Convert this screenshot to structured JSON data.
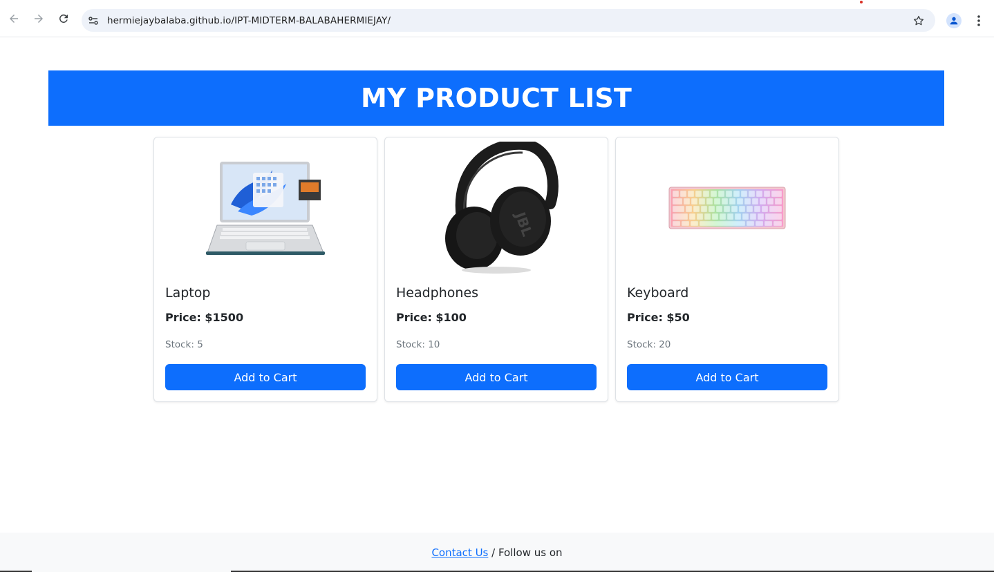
{
  "browser": {
    "url": "hermiejaybalaba.github.io/IPT-MIDTERM-BALABAHERMIEJAY/",
    "icons": [
      "back-icon",
      "forward-icon",
      "reload-icon",
      "site-info-icon",
      "bookmark-star-icon",
      "profile-icon",
      "menu-dots-icon"
    ]
  },
  "header": {
    "title": "MY PRODUCT LIST",
    "background": "#0d6efd"
  },
  "products": [
    {
      "name": "Laptop",
      "price": "Price: $1500",
      "stock": "Stock: 5",
      "button": "Add to Cart"
    },
    {
      "name": "Headphones",
      "price": "Price: $100",
      "stock": "Stock: 10",
      "button": "Add to Cart"
    },
    {
      "name": "Keyboard",
      "price": "Price: $50",
      "stock": "Stock: 20",
      "button": "Add to Cart"
    }
  ],
  "footer": {
    "contact_link": "Contact Us",
    "follow_text": " / Follow us on"
  },
  "colors": {
    "accent": "#0d6efd",
    "footer_bg": "#f8f9fa"
  }
}
